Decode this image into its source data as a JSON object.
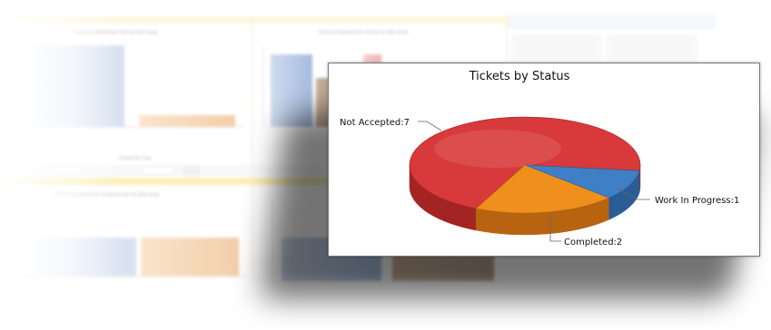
{
  "chart_data": {
    "type": "pie",
    "title": "Tickets by Status",
    "slices": [
      {
        "label": "Not Accepted",
        "value": 7,
        "color": "#d8393a",
        "dark": "#a42424"
      },
      {
        "label": "Completed",
        "value": 2,
        "color": "#ef8f1c",
        "dark": "#b86310"
      },
      {
        "label": "Work In Progress",
        "value": 1,
        "color": "#3f7fc6",
        "dark": "#2a5c96"
      }
    ],
    "legend": "none",
    "style": "3d"
  },
  "data_labels": {
    "not_accepted": "Not Accepted:7",
    "completed": "Completed:2",
    "work_in_progress": "Work In Progress:1"
  }
}
